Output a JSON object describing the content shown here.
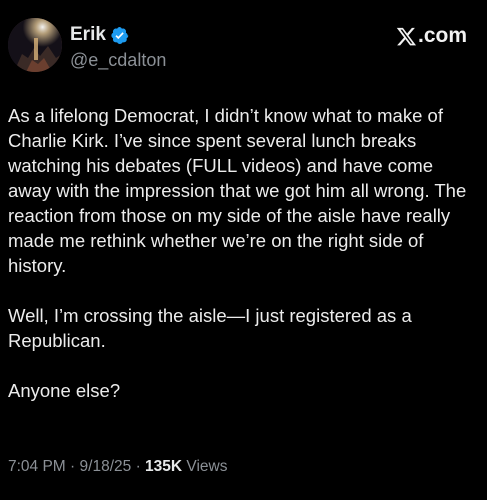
{
  "author": {
    "name": "Erik",
    "handle": "@e_cdalton",
    "verified_color": "#1d9bf0",
    "avatar_icon": "profile-photo"
  },
  "brand": {
    "label": ".com",
    "icon": "x-logo-icon"
  },
  "tweet": {
    "paragraphs": [
      "As a lifelong Democrat, I didn’t know what to make of Charlie Kirk. I’ve since spent several lunch breaks watching his debates (FULL videos) and have come away with the impression that we got him all wrong. The reaction from those on my side of the aisle have really made me rethink whether we’re on the right side of history.",
      "Well, I’m crossing the aisle—I just registered as a Republican.",
      "Anyone else?"
    ]
  },
  "meta": {
    "time": "7:04 PM",
    "separator": "·",
    "date": "9/18/25",
    "views_count": "135K",
    "views_label": "Views"
  }
}
